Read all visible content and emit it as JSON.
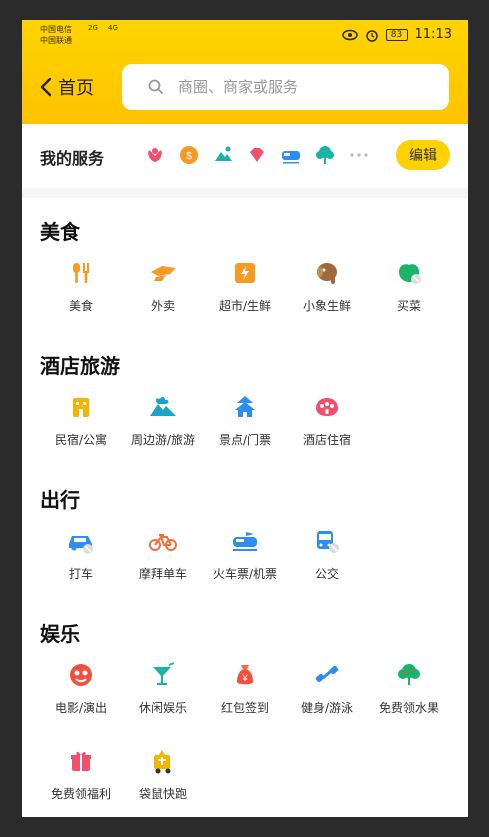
{
  "status_bar": {
    "carrier1": "中国电信",
    "carrier2": "中国联通",
    "net1": "2G",
    "net2": "4G",
    "battery": "83",
    "time": "11:13"
  },
  "header": {
    "back_label": "首页",
    "search_placeholder": "商圈、商家或服务"
  },
  "my_services": {
    "title": "我的服务",
    "edit_label": "编辑",
    "icons": [
      "lotus-icon",
      "coin-icon",
      "beach-icon",
      "gem-icon",
      "train-icon",
      "tree-icon",
      "more-dots-icon"
    ]
  },
  "sections": [
    {
      "title": "美食",
      "items": [
        {
          "label": "美食",
          "icon": "fork-knife-icon"
        },
        {
          "label": "外卖",
          "icon": "delivery-icon"
        },
        {
          "label": "超市/生鲜",
          "icon": "bolt-bag-icon"
        },
        {
          "label": "小象生鲜",
          "icon": "elephant-icon"
        },
        {
          "label": "买菜",
          "icon": "vegetable-icon"
        }
      ]
    },
    {
      "title": "酒店旅游",
      "items": [
        {
          "label": "民宿/公寓",
          "icon": "house-icon"
        },
        {
          "label": "周边游/旅游",
          "icon": "palm-tree-icon"
        },
        {
          "label": "景点/门票",
          "icon": "pagoda-icon"
        },
        {
          "label": "酒店住宿",
          "icon": "hotel-icon"
        }
      ]
    },
    {
      "title": "出行",
      "items": [
        {
          "label": "打车",
          "icon": "taxi-icon"
        },
        {
          "label": "摩拜单车",
          "icon": "bike-icon"
        },
        {
          "label": "火车票/机票",
          "icon": "train-ticket-icon"
        },
        {
          "label": "公交",
          "icon": "bus-icon"
        }
      ]
    },
    {
      "title": "娱乐",
      "items": [
        {
          "label": "电影/演出",
          "icon": "movie-icon"
        },
        {
          "label": "休闲娱乐",
          "icon": "cocktail-icon"
        },
        {
          "label": "红包签到",
          "icon": "red-envelope-icon"
        },
        {
          "label": "健身/游泳",
          "icon": "dumbbell-icon"
        },
        {
          "label": "免费领水果",
          "icon": "fruit-tree-icon"
        },
        {
          "label": "免费领福利",
          "icon": "gift-icon"
        },
        {
          "label": "袋鼠快跑",
          "icon": "kangaroo-icon"
        }
      ]
    }
  ],
  "colors": {
    "brand_yellow": "#ffc300",
    "orange": "#f59a23",
    "teal": "#19b4a4",
    "blue": "#2b8ef0",
    "red": "#f0503c",
    "pink": "#f0506e"
  }
}
